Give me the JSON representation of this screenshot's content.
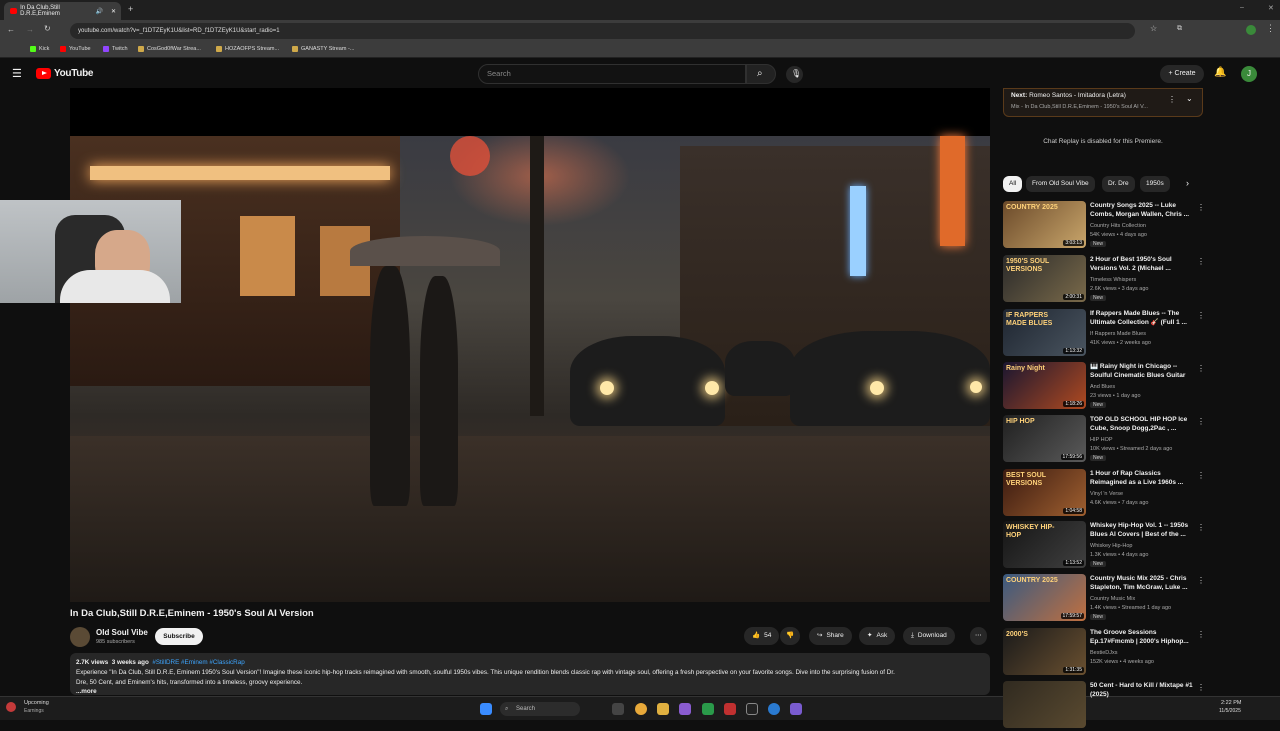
{
  "browser": {
    "tab_title": "In Da Club,Still D.R.E,Eminem",
    "url": "youtube.com/watch?v=_f1DTZEyK1U&list=RD_f1DTZEyK1U&start_radio=1",
    "bookmarks": [
      {
        "label": "Kick",
        "color": "#53fc18"
      },
      {
        "label": "YouTube",
        "color": "#ff0000"
      },
      {
        "label": "Twitch",
        "color": "#9146ff"
      },
      {
        "label": "CosGod0fWar Strea...",
        "color": "#cfa94a"
      },
      {
        "label": "HOZAOFPS Stream...",
        "color": "#cfa94a"
      },
      {
        "label": "GANASTY Stream -...",
        "color": "#cfa94a"
      }
    ]
  },
  "header": {
    "logo_text": "YouTube",
    "search_placeholder": "Search",
    "create_label": "Create",
    "avatar_letter": "J"
  },
  "video": {
    "title": "In Da Club,Still D.R.E,Eminem - 1950's Soul AI Version",
    "channel": "Old Soul Vibe",
    "subscribers": "985 subscribers",
    "subscribe_label": "Subscribe",
    "likes": "54",
    "share_label": "Share",
    "ask_label": "Ask",
    "download_label": "Download",
    "description": {
      "views": "2.7K views",
      "age": "3 weeks ago",
      "tags": "#StillDRE #Eminem #ClassicRap",
      "line1": "Experience \"In Da Club, Still D.R.E, Eminem 1950's Soul Version\"! Imagine these iconic hip-hop tracks reimagined with smooth, soulful 1950s vibes. This unique rendition blends classic rap with vintage soul, offering a fresh perspective on your favorite songs. Dive into the surprising fusion of Dr.",
      "line2": "Dre, 50 Cent, and Eminem's hits, transformed into a timeless, groovy experience.",
      "more": "...more"
    }
  },
  "sidebar": {
    "next_label": "Next:",
    "next_title": "Romeo Santos - Imitadora (Letra)",
    "next_sub": "Mix - In Da Club,Still D.R.E,Eminem - 1950's Soul AI V...",
    "chat_replay": "Chat Replay is disabled for this Premiere.",
    "chips": [
      "All",
      "From Old Soul Vibe",
      "Dr. Dre",
      "1950s"
    ],
    "recommendations": [
      {
        "title": "Country Songs 2025 -- Luke Combs, Morgan Wallen, Chris ...",
        "channel": "Country Hits Collection",
        "meta": "54K views • 4 days ago",
        "badge": "New",
        "duration": "3:03:13",
        "thumb_text": "COUNTRY 2025",
        "c1": "#6b4a2a",
        "c2": "#c9a66b"
      },
      {
        "title": "2 Hour of Best 1950's Soul Versions Vol. 2 (Michael ...",
        "channel": "Timeless Whispers",
        "meta": "2.6K views • 3 days ago",
        "badge": "New",
        "duration": "2:00:31",
        "thumb_text": "1950'S SOUL VERSIONS",
        "c1": "#2a2a2a",
        "c2": "#7a6a4a"
      },
      {
        "title": "If Rappers Made Blues -- The Ultimate Collection 🎸 (Full 1 ...",
        "channel": "If Rappers Made Blues",
        "meta": "41K views • 2 weeks ago",
        "badge": "",
        "duration": "1:13:32",
        "thumb_text": "IF RAPPERS MADE BLUES",
        "c1": "#1e2530",
        "c2": "#4a5560"
      },
      {
        "title": "🎹 Rainy Night in Chicago -- Soulful Cinematic Blues Guitar",
        "channel": "And Blues",
        "meta": "23 views • 1 day ago",
        "badge": "New",
        "duration": "1:18:26",
        "thumb_text": "Rainy Night",
        "c1": "#1a1630",
        "c2": "#b04a20"
      },
      {
        "title": "TOP OLD SCHOOL HIP HOP Ice Cube, Snoop Dogg,2Pac , ...",
        "channel": "HIP HOP",
        "meta": "10K views • Streamed 2 days ago",
        "badge": "New",
        "duration": "17:59:56",
        "thumb_text": "HIP HOP",
        "c1": "#202020",
        "c2": "#5a5a5a"
      },
      {
        "title": "1 Hour of Rap Classics Reimagined as a Live 1960s ...",
        "channel": "Vinyl 'n Verse",
        "meta": "4.6K views • 7 days ago",
        "badge": "",
        "duration": "1:04:58",
        "thumb_text": "BEST SOUL VERSIONS",
        "c1": "#3a1a10",
        "c2": "#a06030"
      },
      {
        "title": "Whiskey Hip-Hop Vol. 1 -- 1950s Blues AI Covers | Best of the ...",
        "channel": "Whiskey Hip-Hop",
        "meta": "1.3K views • 4 days ago",
        "badge": "New",
        "duration": "1:13:52",
        "thumb_text": "WHISKEY HIP-HOP",
        "c1": "#151515",
        "c2": "#404040"
      },
      {
        "title": "Country Music Mix 2025 - Chris Stapleton, Tim McGraw, Luke ...",
        "channel": "Country Music Mix",
        "meta": "1.4K views • Streamed 1 day ago",
        "badge": "New",
        "duration": "17:59:57",
        "thumb_text": "COUNTRY 2025",
        "c1": "#3a5a80",
        "c2": "#c07040"
      },
      {
        "title": "The Groove Sessions Ep.17#Fmcmb | 2000's Hiphop...",
        "channel": "BestieDJxs",
        "meta": "152K views • 4 weeks ago",
        "badge": "",
        "duration": "1:31:35",
        "thumb_text": "2000'S",
        "c1": "#1a1a1a",
        "c2": "#6a5030"
      },
      {
        "title": "50 Cent - Hard to Kill / Mixtape #1 (2025)",
        "channel": "",
        "meta": "",
        "badge": "",
        "duration": "",
        "thumb_text": "",
        "c1": "#302a20",
        "c2": "#5a4a30"
      }
    ]
  },
  "taskbar": {
    "weather_label": "Upcoming",
    "weather_sub": "Earnings",
    "search_label": "Search",
    "time": "2:22 PM",
    "date": "11/5/2025"
  }
}
